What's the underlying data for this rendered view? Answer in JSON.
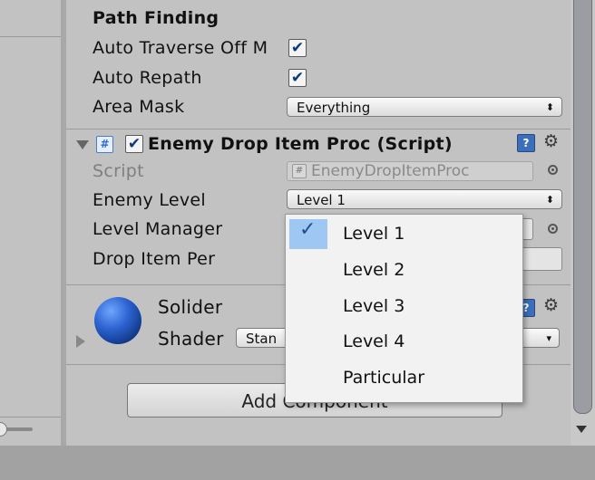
{
  "path_finding": {
    "header": "Path Finding",
    "auto_traverse_label": "Auto Traverse Off M",
    "auto_traverse_checked": true,
    "auto_repath_label": "Auto Repath",
    "auto_repath_checked": true,
    "area_mask_label": "Area Mask",
    "area_mask_value": "Everything"
  },
  "component": {
    "title": "Enemy Drop Item Proc (Script)",
    "enabled": true,
    "script_label": "Script",
    "script_value": "EnemyDropItemProc",
    "enemy_level_label": "Enemy Level",
    "enemy_level_value": "Level 1",
    "level_manager_label": "Level Manager",
    "drop_item_per_label": "Drop Item Per"
  },
  "material": {
    "name": "Solider",
    "shader_label": "Shader",
    "shader_value": "Stan"
  },
  "add_component_label": "Add Component",
  "popup": {
    "items": [
      {
        "label": "Level 1",
        "selected": true
      },
      {
        "label": "Level 2",
        "selected": false
      },
      {
        "label": "Level 3",
        "selected": false
      },
      {
        "label": "Level 4",
        "selected": false
      },
      {
        "label": "Particular",
        "selected": false
      }
    ],
    "check_glyph": "✓"
  },
  "colors": {
    "panel_bg": "#c2c2c2",
    "selection": "#9ec7f3",
    "sphere": "#2d63d1"
  },
  "icons": {
    "checkbox": "checkmark-icon",
    "script": "cs-script-icon",
    "help": "help-book-icon",
    "settings": "gear-icon",
    "object_picker": "object-picker-icon",
    "foldout": "foldout-arrow-icon"
  }
}
